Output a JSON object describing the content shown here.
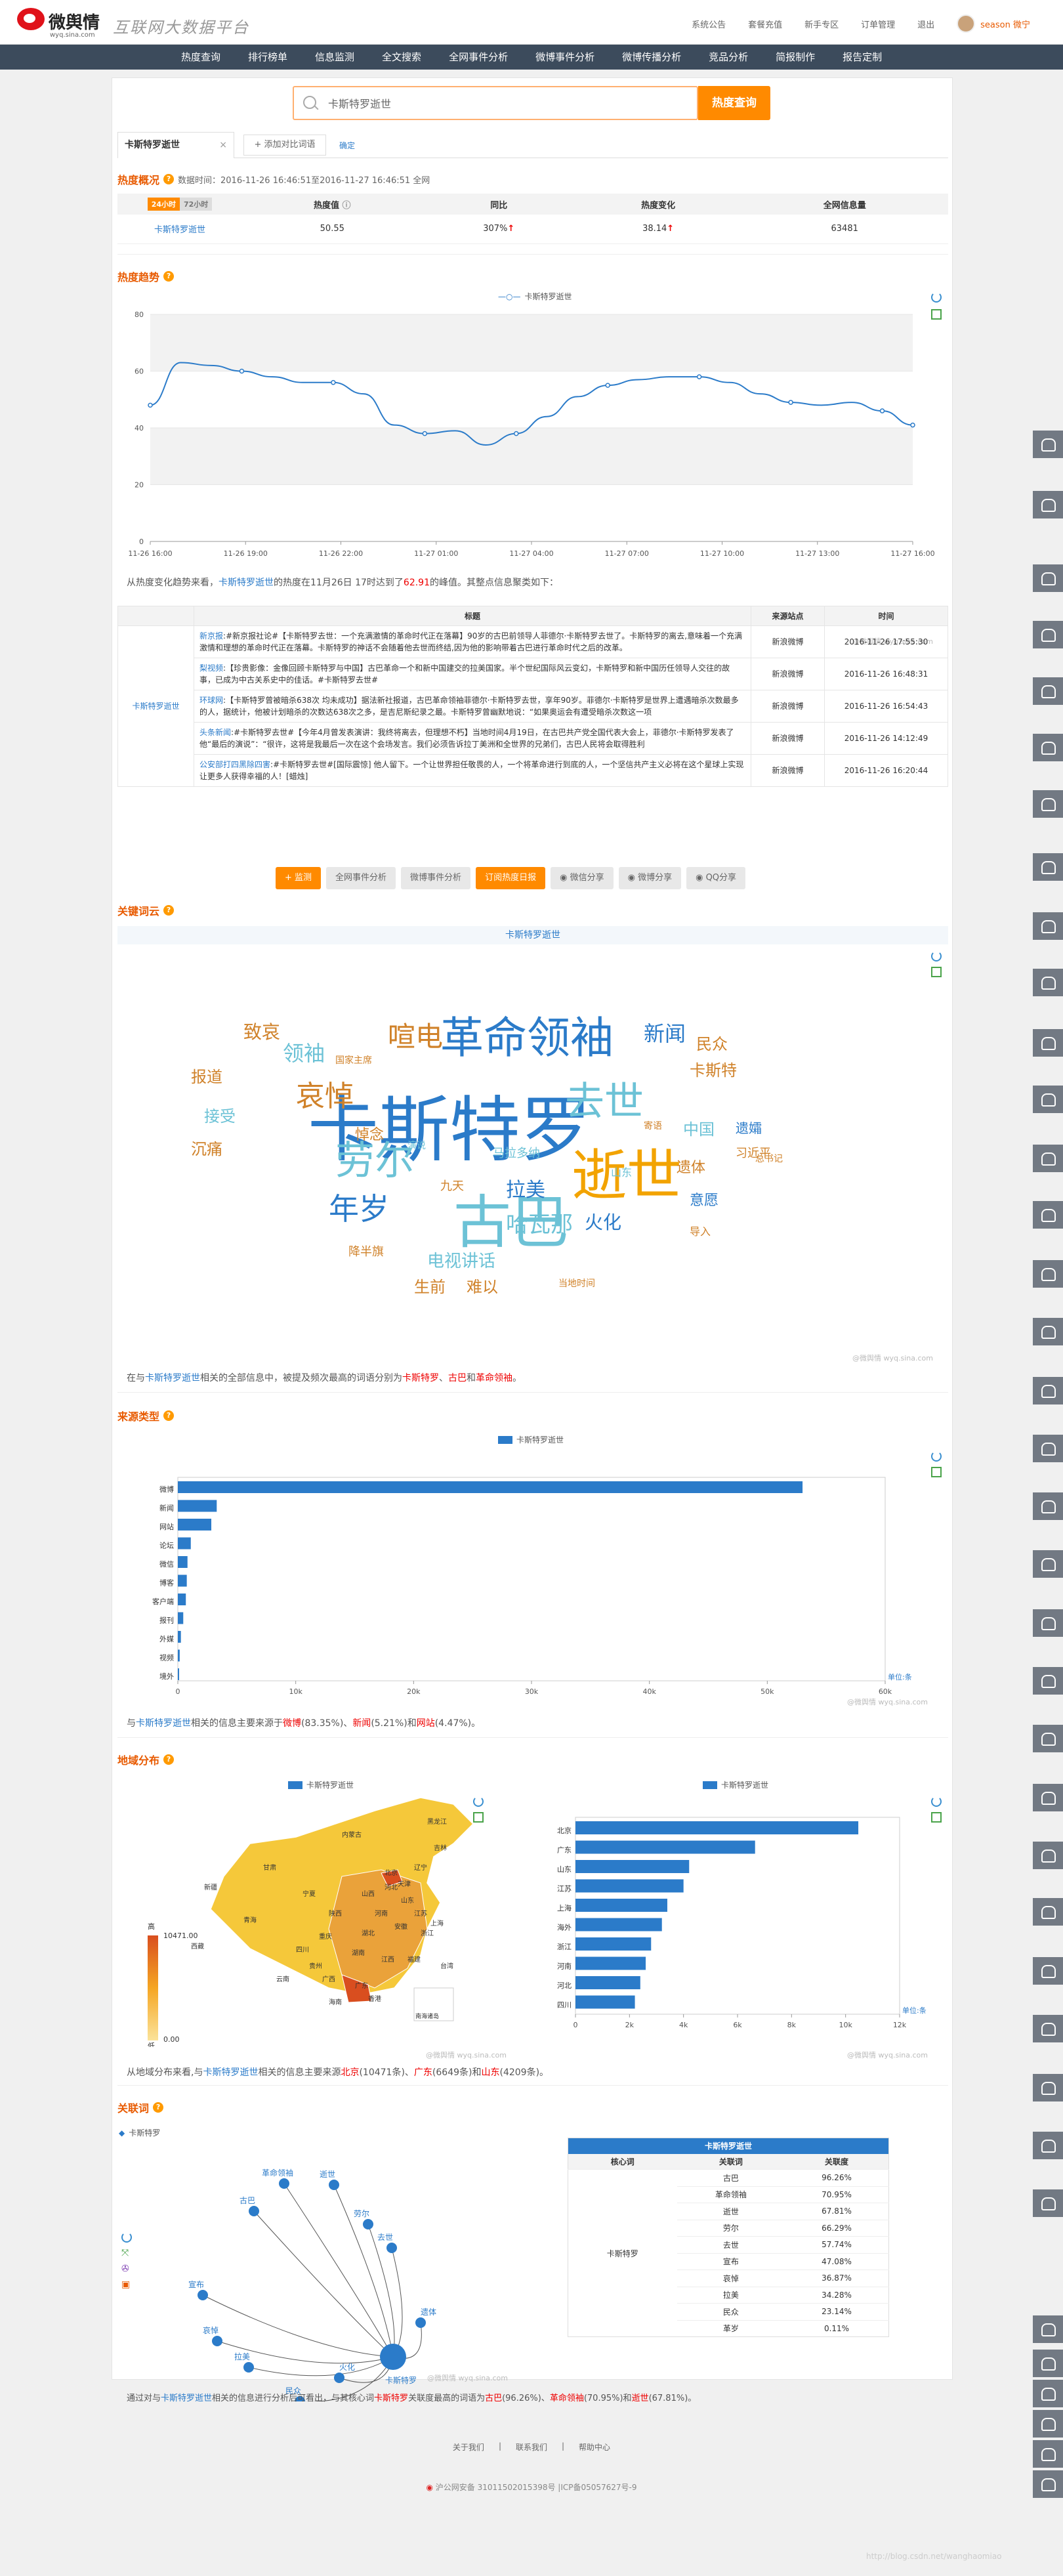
{
  "header": {
    "logo_name": "微舆情",
    "logo_url": "wyq.sina.com",
    "slogan": "互联网大数据平台",
    "links": [
      "系统公告",
      "套餐充值",
      "新手专区",
      "订单管理",
      "退出"
    ],
    "username": "season 微宁"
  },
  "nav": [
    "热度查询",
    "排行榜单",
    "信息监测",
    "全文搜索",
    "全网事件分析",
    "微博事件分析",
    "微博传播分析",
    "竞品分析",
    "简报制作",
    "报告定制"
  ],
  "search": {
    "value": "卡斯特罗逝世",
    "button": "热度查询"
  },
  "tabs": {
    "keyword": "卡斯特罗逝世",
    "close": "×",
    "add": "+ 添加对比词语",
    "confirm": "确定"
  },
  "overview": {
    "title": "热度概况",
    "data_time": "数据时间：2016-11-26 16:46:51至2016-11-27 16:46:51 全网",
    "toggle": [
      "24小时",
      "72小时"
    ],
    "headers": [
      "热度值",
      "同比",
      "热度变化",
      "全网信息量"
    ],
    "row": {
      "keyword": "卡斯特罗逝世",
      "value": "50.55",
      "yoy": "307%",
      "change": "38.14",
      "count": "63481"
    }
  },
  "trend": {
    "title": "热度趋势",
    "legend": "卡斯特罗逝世",
    "analysis": {
      "pre": "从热度变化趋势来看，",
      "kw": "卡斯特罗逝世",
      "mid": "的热度在11月26日 17时达到了",
      "peak": "62.91",
      "post": "的峰值。其整点信息聚类如下："
    },
    "watermark": "@微舆情 wyq.sina.com"
  },
  "chart_data": [
    {
      "type": "line",
      "series": [
        {
          "name": "卡斯特罗逝世",
          "values": [
            48,
            63,
            62,
            60,
            58,
            56,
            56,
            52,
            41,
            38,
            39,
            34,
            38,
            44,
            51,
            55,
            57,
            58,
            58,
            56,
            52,
            49,
            48,
            49,
            46,
            41
          ]
        }
      ],
      "x": [
        "11-26 16:00",
        "11-26 17:00",
        "11-26 18:00",
        "11-26 19:00",
        "11-26 20:00",
        "11-26 21:00",
        "11-26 22:00",
        "11-26 23:00",
        "11-27 00:00",
        "11-27 01:00",
        "11-27 02:00",
        "11-27 03:00",
        "11-27 04:00",
        "11-27 05:00",
        "11-27 06:00",
        "11-27 07:00",
        "11-27 08:00",
        "11-27 09:00",
        "11-27 10:00",
        "11-27 11:00",
        "11-27 12:00",
        "11-27 13:00",
        "11-27 14:00",
        "11-27 15:00",
        "11-27 16:00",
        "11-27 16:00"
      ],
      "xticks": [
        "11-26 16:00",
        "11-26 19:00",
        "11-26 22:00",
        "11-27 01:00",
        "11-27 04:00",
        "11-27 07:00",
        "11-27 10:00",
        "11-27 13:00",
        "11-27 16:00"
      ],
      "ylim": [
        0,
        80
      ],
      "yticks": [
        0,
        20,
        40,
        60,
        80
      ]
    },
    {
      "type": "bar",
      "categories": [
        "微博",
        "新闻",
        "网站",
        "论坛",
        "微信",
        "博客",
        "客户端",
        "报刊",
        "外媒",
        "视频",
        "境外"
      ],
      "series": [
        {
          "name": "卡斯特罗逝世",
          "values": [
            52990,
            3300,
            2840,
            1100,
            820,
            760,
            680,
            460,
            260,
            160,
            110
          ]
        }
      ],
      "xlim": [
        0,
        60000
      ],
      "xticks": [
        "0",
        "10k",
        "20k",
        "30k",
        "40k",
        "50k",
        "60k"
      ],
      "unit": "单位:条"
    },
    {
      "type": "bar",
      "categories": [
        "北京",
        "广东",
        "山东",
        "江苏",
        "上海",
        "海外",
        "浙江",
        "河南",
        "河北",
        "四川"
      ],
      "series": [
        {
          "name": "卡斯特罗逝世",
          "values": [
            10471,
            6649,
            4209,
            4000,
            3400,
            3200,
            2800,
            2600,
            2400,
            2200
          ]
        }
      ],
      "xlim": [
        0,
        12000
      ],
      "xticks": [
        "0",
        "2k",
        "4k",
        "6k",
        "8k",
        "10k",
        "12k"
      ],
      "unit": "单位:条"
    }
  ],
  "weibo_table": {
    "headers": [
      "标题",
      "来源站点",
      "时间"
    ],
    "keyword": "卡斯特罗逝世",
    "rows": [
      {
        "src": "新京报",
        "text": "#新京报社论#【卡斯特罗去世：一个充满激情的革命时代正在落幕】90岁的古巴前领导人菲德尔·卡斯特罗去世了。卡斯特罗的离去,意味着一个充满激情和理想的革命时代正在落幕。卡斯特罗的神话不会随着他去世而终结,因为他的影响带着古巴进行革命时代之后的改革。",
        "site": "新浪微博",
        "time": "2016-11-26 17:55:30"
      },
      {
        "src": "梨视频",
        "text": "【珍贵影像：金像回顾卡斯特罗与中国】古巴革命一个和新中国建交的拉美国家。半个世纪国际风云变幻，卡斯特罗和新中国历任领导人交往的故事，已成为中古关系史中的佳话。#卡斯特罗去世#",
        "site": "新浪微博",
        "time": "2016-11-26 16:48:31"
      },
      {
        "src": "环球网",
        "text": "【卡斯特罗曾被暗杀638次 均未成功】据法新社报道，古巴革命领袖菲德尔·卡斯特罗去世，享年90岁。菲德尔·卡斯特罗是世界上遭遇暗杀次数最多的人，据统计，他被计划暗杀的次数达638次之多，是吉尼斯纪录之最。卡斯特罗曾幽默地说：“如果奥运会有遭受暗杀次数这一项",
        "site": "新浪微博",
        "time": "2016-11-26 16:54:43"
      },
      {
        "src": "头条新闻",
        "text": "#卡斯特罗去世#【今年4月曾发表演讲：我终将离去，但理想不朽】当地时间4月19日，在古巴共产党全国代表大会上，菲德尔·卡斯特罗发表了他“最后的演说”：“很许，这将是我最后一次在这个会场发言。我们必须告诉拉丁美洲和全世界的兄弟们，古巴人民将会取得胜利",
        "site": "新浪微博",
        "time": "2016-11-26 14:12:49"
      },
      {
        "src": "公安部打四黑除四害",
        "text": "#卡斯特罗去世#[国际震惊] 他人留下。一个让世界担任敬畏的人，一个将革命进行到底的人，一个坚信共产主义必将在这个星球上实现让更多人获得幸福的人！[蜡烛]",
        "site": "新浪微博",
        "time": "2016-11-26 16:20:44"
      }
    ]
  },
  "buttons": [
    "+ 监测",
    "全网事件分析",
    "微博事件分析",
    "订阅热度日报",
    "微信分享",
    "微博分享",
    "QQ分享"
  ],
  "wordcloud": {
    "title": "关键词云",
    "header": "卡斯特罗逝世",
    "words": [
      {
        "t": "卡斯特罗",
        "c": "#2b7bc9"
      },
      {
        "t": "古巴",
        "c": "#6cc2d6"
      },
      {
        "t": "逝世",
        "c": "#f2a300"
      },
      {
        "t": "革命领袖",
        "c": "#2b7bc9"
      },
      {
        "t": "劳尔",
        "c": "#6cc2d6"
      },
      {
        "t": "去世",
        "c": "#6cc2d6"
      },
      {
        "t": "哀悼",
        "c": "#d0822a"
      },
      {
        "t": "年岁",
        "c": "#2b7bc9"
      },
      {
        "t": "哈瓦那",
        "c": "#6cc2d6"
      },
      {
        "t": "喧电",
        "c": "#d0822a"
      },
      {
        "t": "领袖",
        "c": "#6cc2d6"
      },
      {
        "t": "新闻",
        "c": "#2b7bc9"
      },
      {
        "t": "拉美",
        "c": "#2b7bc9"
      },
      {
        "t": "火化",
        "c": "#2b7bc9"
      },
      {
        "t": "电视讲话",
        "c": "#6cc2d6"
      },
      {
        "t": "致哀",
        "c": "#d0822a"
      },
      {
        "t": "民众",
        "c": "#d0822a"
      },
      {
        "t": "卡斯特",
        "c": "#d0822a"
      },
      {
        "t": "中国",
        "c": "#6cc2d6"
      },
      {
        "t": "遗体",
        "c": "#d0822a"
      },
      {
        "t": "报道",
        "c": "#d0822a"
      },
      {
        "t": "遗孀",
        "c": "#2b7bc9"
      },
      {
        "t": "接受",
        "c": "#6cc2d6"
      },
      {
        "t": "沉痛",
        "c": "#d0822a"
      },
      {
        "t": "意愿",
        "c": "#2b7bc9"
      },
      {
        "t": "难以",
        "c": "#d0822a"
      },
      {
        "t": "生前",
        "c": "#d0822a"
      },
      {
        "t": "悼念",
        "c": "#d0822a"
      },
      {
        "t": "习近平",
        "c": "#d0822a"
      },
      {
        "t": "山东",
        "c": "#6cc2d6"
      },
      {
        "t": "马拉多纳",
        "c": "#6cc2d6"
      },
      {
        "t": "寄语",
        "c": "#d0822a"
      },
      {
        "t": "九天",
        "c": "#d0822a"
      },
      {
        "t": "降半旗",
        "c": "#d0822a"
      },
      {
        "t": "当地时间",
        "c": "#d0822a"
      },
      {
        "t": "国家主席",
        "c": "#d0822a"
      },
      {
        "t": "总书记",
        "c": "#d0822a"
      },
      {
        "t": "演说",
        "c": "#6cc2d6"
      },
      {
        "t": "导入",
        "c": "#d0822a"
      }
    ],
    "analysis": {
      "pre": "在与",
      "kw": "卡斯特罗逝世",
      "mid": "相关的全部信息中，被提及频次最高的词语分别为",
      "a": "卡斯特罗",
      "sep": "、",
      "b": "古巴",
      "and": "和",
      "c": "革命领袖",
      "end": "。"
    }
  },
  "source": {
    "title": "来源类型",
    "legend": "卡斯特罗逝世",
    "analysis": {
      "pre": "与",
      "kw": "卡斯特罗逝世",
      "mid": "相关的信息主要来源于",
      "a": "微博",
      "ap": "(83.35%)、",
      "b": "新闻",
      "bp": "(5.21%)和",
      "c": "网站",
      "cp": "(4.47%)。"
    }
  },
  "region": {
    "title": "地域分布",
    "legend": "卡斯特罗逝世",
    "scale_high": "高",
    "scale_low": "低",
    "scale_max": "10471.00",
    "scale_min": "0.00",
    "provinces": [
      "新疆",
      "西藏",
      "青海",
      "甘肃",
      "内蒙古",
      "四川",
      "云南",
      "黑龙江",
      "吉林",
      "辽宁",
      "北京",
      "河北",
      "山东",
      "河南",
      "湖北",
      "湖南",
      "广东",
      "广西",
      "江西",
      "福建",
      "浙江",
      "安徽",
      "江苏",
      "陕西",
      "山西",
      "贵州",
      "重庆",
      "宁夏",
      "天津",
      "上海",
      "海南",
      "台湾",
      "香港"
    ],
    "islands": "南海诸岛",
    "analysis": {
      "pre": "从地域分布来看,与",
      "kw": "卡斯特罗逝世",
      "mid": "相关的信息主要来源",
      "a": "北京",
      "ap": "(10471条)、",
      "b": "广东",
      "bp": "(6649条)和",
      "c": "山东",
      "cp": "(4209条)。"
    }
  },
  "relation": {
    "title": "关联词",
    "legend": "卡斯特罗",
    "center": "卡斯特罗",
    "nodes": [
      "古巴",
      "革命领袖",
      "逝世",
      "劳尔",
      "去世",
      "宣布",
      "哀悼",
      "拉美",
      "民众",
      "遗体",
      "火化"
    ],
    "table_title": "卡斯特罗逝世",
    "table_headers": [
      "核心词",
      "关联词",
      "关联度"
    ],
    "core": "卡斯特罗",
    "rows": [
      [
        "古巴",
        "96.26%"
      ],
      [
        "革命领袖",
        "70.95%"
      ],
      [
        "逝世",
        "67.81%"
      ],
      [
        "劳尔",
        "66.29%"
      ],
      [
        "去世",
        "57.74%"
      ],
      [
        "宣布",
        "47.08%"
      ],
      [
        "哀悼",
        "36.87%"
      ],
      [
        "拉美",
        "34.28%"
      ],
      [
        "民众",
        "23.14%"
      ],
      [
        "革岁",
        "0.11%"
      ]
    ],
    "analysis": {
      "pre": "通过对与",
      "kw": "卡斯特罗逝世",
      "mid": "相关的信息进行分析后可看出，与其核心词",
      "core": "卡斯特罗",
      "mid2": "关联度最高的词语为",
      "a": "古巴",
      "ap": "(96.26%)、",
      "b": "革命领袖",
      "bp": "(70.95%)和",
      "c": "逝世",
      "cp": "(67.81%)。"
    }
  },
  "footer": {
    "links": [
      "关于我们",
      "|",
      "联系我们",
      "|",
      "帮助中心"
    ],
    "icp": "沪公网安备 31011502015398号 |ICP备05057627号-9",
    "blog": "http://blog.csdn.net/wanghaomiao"
  }
}
